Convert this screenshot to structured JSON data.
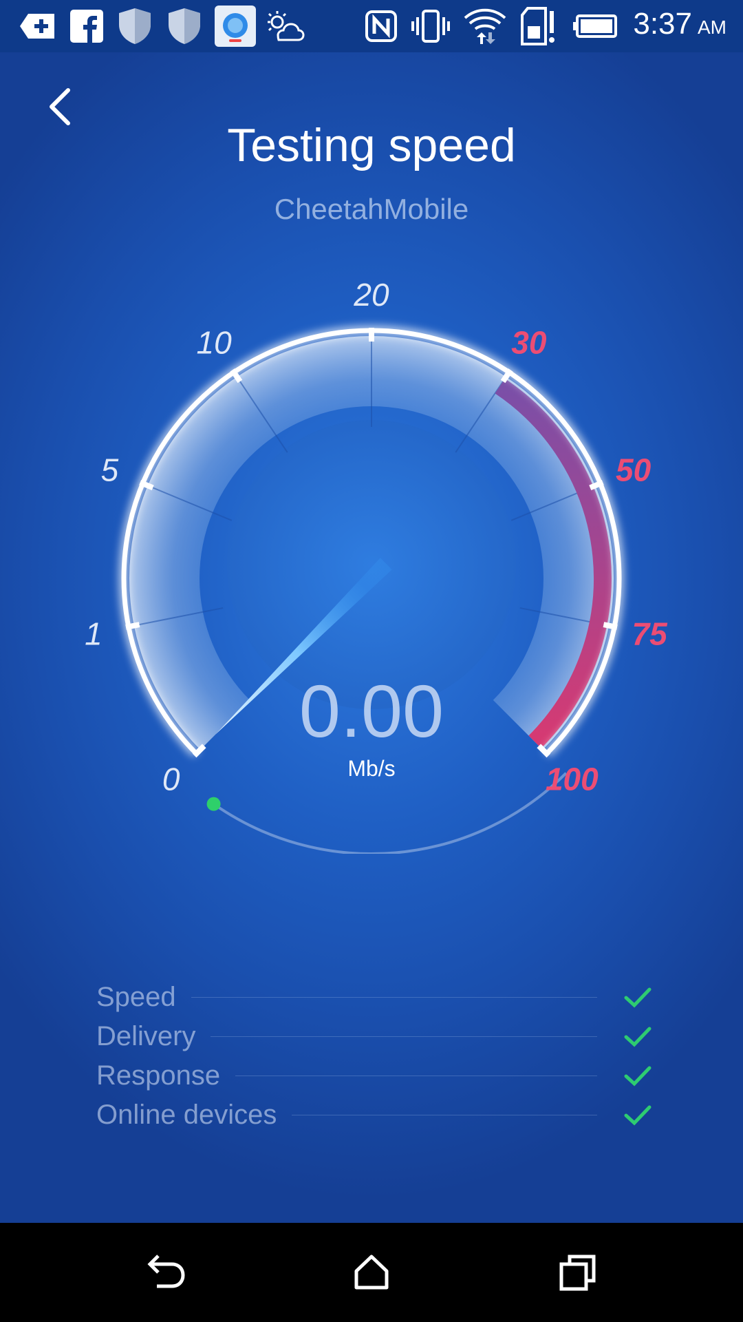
{
  "status_bar": {
    "time": "3:37",
    "ampm": "AM",
    "icons": [
      "add-message-icon",
      "facebook-icon",
      "shield-icon",
      "shield-icon",
      "speedtest-app-icon",
      "weather-partly-cloudy-icon",
      "nfc-icon",
      "vibrate-icon",
      "wifi-icon",
      "sd-card-alert-icon",
      "battery-icon"
    ]
  },
  "header": {
    "title": "Testing speed",
    "network_name": "CheetahMobile"
  },
  "gauge": {
    "scale_labels": [
      {
        "text": "0",
        "highlight": false
      },
      {
        "text": "1",
        "highlight": false
      },
      {
        "text": "5",
        "highlight": false
      },
      {
        "text": "10",
        "highlight": false
      },
      {
        "text": "20",
        "highlight": false
      },
      {
        "text": "30",
        "highlight": true
      },
      {
        "text": "50",
        "highlight": true
      },
      {
        "text": "75",
        "highlight": true
      },
      {
        "text": "100",
        "highlight": true
      }
    ],
    "speed_value": "0.00",
    "unit": "Mb/s",
    "normal_color": "#dfe8f7",
    "highlight_color": "#ec4d74",
    "indicator_color": "#2ed06a"
  },
  "checklist": [
    {
      "label": "Speed",
      "done": true
    },
    {
      "label": "Delivery",
      "done": true
    },
    {
      "label": "Response",
      "done": true
    },
    {
      "label": "Online devices",
      "done": true
    }
  ],
  "colors": {
    "accent": "#2ecc71",
    "status_bar": "#0e3a8a",
    "background": "#1f5fc4"
  },
  "navigation": {
    "icons": [
      "back-icon",
      "home-icon",
      "recents-icon"
    ]
  }
}
